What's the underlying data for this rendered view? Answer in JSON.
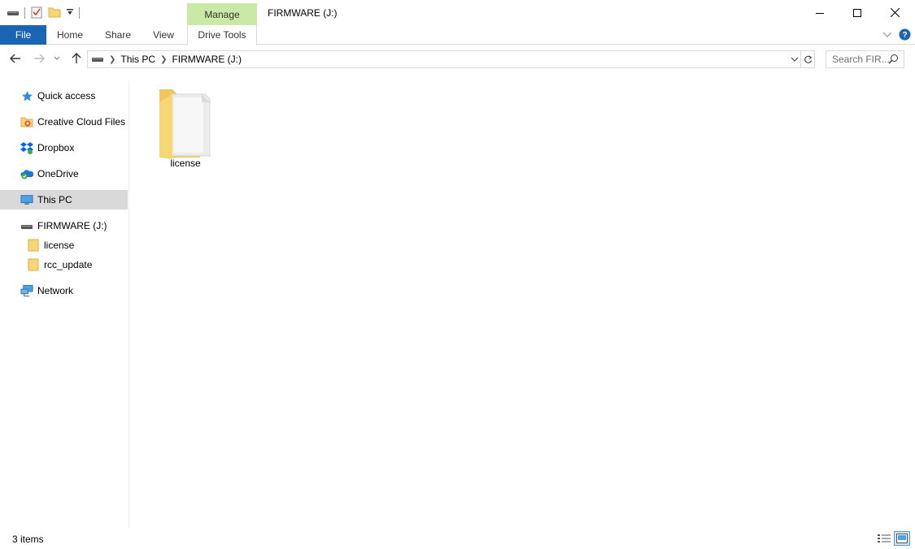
{
  "window": {
    "title": "FIRMWARE (J:)",
    "contextual_tab": "Manage"
  },
  "ribbon": {
    "tabs": [
      "File",
      "Home",
      "Share",
      "View",
      "Drive Tools"
    ]
  },
  "address": {
    "crumbs": [
      "This PC",
      "FIRMWARE (J:)"
    ]
  },
  "search": {
    "placeholder": "Search FIR..."
  },
  "nav": {
    "items": [
      {
        "label": "Quick access",
        "icon": "star-icon"
      },
      {
        "label": "Creative Cloud Files",
        "icon": "creative-cloud-icon"
      },
      {
        "label": "Dropbox",
        "icon": "dropbox-icon"
      },
      {
        "label": "OneDrive",
        "icon": "onedrive-icon"
      },
      {
        "label": "This PC",
        "icon": "computer-icon",
        "selected": true
      },
      {
        "label": "FIRMWARE (J:)",
        "icon": "drive-icon"
      },
      {
        "label": "license",
        "icon": "folder-icon"
      },
      {
        "label": "rcc_update",
        "icon": "folder-icon"
      },
      {
        "label": "Network",
        "icon": "network-icon"
      }
    ]
  },
  "content": {
    "items": [
      {
        "label": "license",
        "icon": "folder-icon"
      }
    ]
  },
  "status": {
    "item_count": "3 items"
  },
  "colors": {
    "file_tab": "#1a64b4",
    "manage_tab": "#cbe9a6",
    "selected_nav": "#d9d9d9"
  }
}
